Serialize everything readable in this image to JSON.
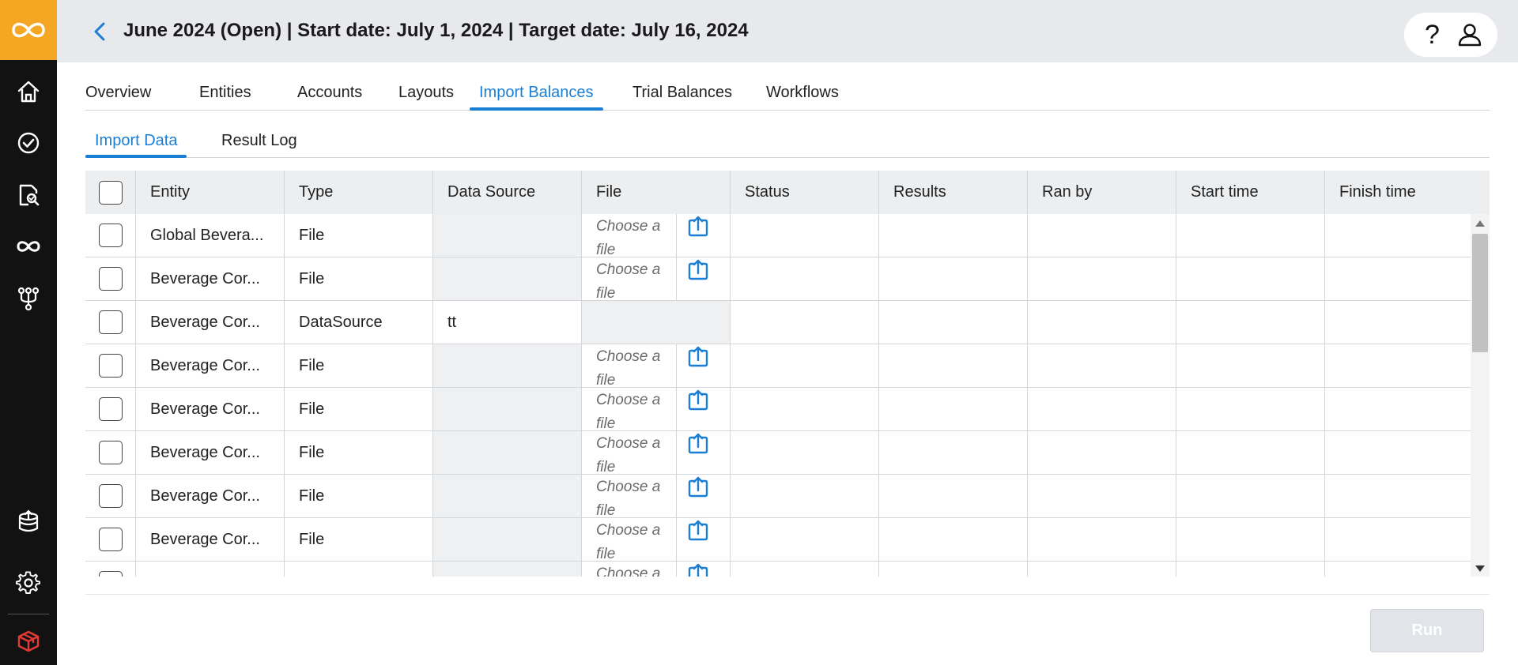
{
  "colors": {
    "accent": "#1a7fd4",
    "brand": "#f5a623",
    "rail": "#121212",
    "header_bg": "#e8e9ec"
  },
  "rail": {
    "logo_icon": "infinity-loop-logo",
    "items": [
      {
        "icon": "home-icon"
      },
      {
        "icon": "check-circle-icon"
      },
      {
        "icon": "document-search-icon"
      },
      {
        "icon": "infinity-icon"
      },
      {
        "icon": "workflow-branch-icon"
      },
      {
        "icon": "database-upload-icon"
      },
      {
        "icon": "gear-icon"
      },
      {
        "icon": "cube-icon"
      }
    ]
  },
  "header": {
    "title": "June 2024 (Open) | Start date: July 1, 2024 | Target date: July 16, 2024",
    "help_label": "?",
    "user_icon": "user-icon"
  },
  "tabs": [
    {
      "label": "Overview"
    },
    {
      "label": "Entities"
    },
    {
      "label": "Accounts"
    },
    {
      "label": "Layouts"
    },
    {
      "label": "Import Balances",
      "active": true
    },
    {
      "label": "Trial Balances"
    },
    {
      "label": "Workflows"
    }
  ],
  "subtabs": [
    {
      "label": "Import Data",
      "active": true
    },
    {
      "label": "Result Log"
    }
  ],
  "grid": {
    "columns": [
      "Entity",
      "Type",
      "Data Source",
      "File",
      "Status",
      "Results",
      "Ran by",
      "Start time",
      "Finish time"
    ],
    "file_placeholder": "Choose a file",
    "rows": [
      {
        "entity": "Global Bevera...",
        "type": "File",
        "data_source": ""
      },
      {
        "entity": "Beverage Cor...",
        "type": "File",
        "data_source": ""
      },
      {
        "entity": "Beverage Cor...",
        "type": "DataSource",
        "data_source": "tt"
      },
      {
        "entity": "Beverage Cor...",
        "type": "File",
        "data_source": ""
      },
      {
        "entity": "Beverage Cor...",
        "type": "File",
        "data_source": ""
      },
      {
        "entity": "Beverage Cor...",
        "type": "File",
        "data_source": ""
      },
      {
        "entity": "Beverage Cor...",
        "type": "File",
        "data_source": ""
      },
      {
        "entity": "Beverage Cor...",
        "type": "File",
        "data_source": ""
      },
      {
        "entity": "",
        "type": "",
        "data_source": ""
      }
    ]
  },
  "run_button": {
    "label": "Run"
  }
}
